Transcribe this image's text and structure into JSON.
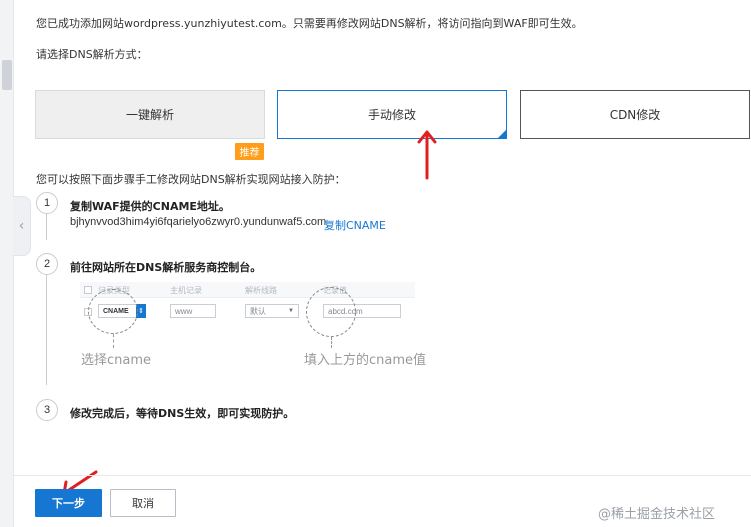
{
  "header": {
    "success_message": "您已成功添加网站wordpress.yunzhiyutest.com。只需要再修改网站DNS解析，将访问指向到WAF即可生效。",
    "choose_label": "请选择DNS解析方式："
  },
  "options": [
    {
      "label": "一键解析",
      "selected": false
    },
    {
      "label": "手动修改",
      "selected": true
    },
    {
      "label": "CDN修改",
      "selected": false
    }
  ],
  "badge": {
    "recommend": "推荐"
  },
  "intro": "您可以按照下面步骤手工修改网站DNS解析实现网站接入防护：",
  "steps": [
    {
      "number": "1",
      "title": "复制WAF提供的CNAME地址。"
    },
    {
      "number": "2",
      "title": "前往网站所在DNS解析服务商控制台。"
    },
    {
      "number": "3",
      "title": "修改完成后，等待DNS生效，即可实现防护。"
    }
  ],
  "cname": {
    "value": "bjhynvvod3him4yi6fqarielyo6zwyr0.yundunwaf5.com",
    "copy_label": "复制CNAME"
  },
  "demo": {
    "headers": [
      "记录类型",
      "主机记录",
      "解析线路",
      "记录值"
    ],
    "type": "CNAME",
    "host": "www",
    "line": "默认",
    "value": "abcd.com",
    "annotation_left": "选择cname",
    "annotation_right": "填入上方的cname值"
  },
  "footer": {
    "next_label": "下一步",
    "cancel_label": "取消"
  },
  "watermark": "@稀土掘金技术社区",
  "colors": {
    "primary": "#1677d2",
    "badge": "#ff9e1b",
    "arrow": "#e02020"
  }
}
